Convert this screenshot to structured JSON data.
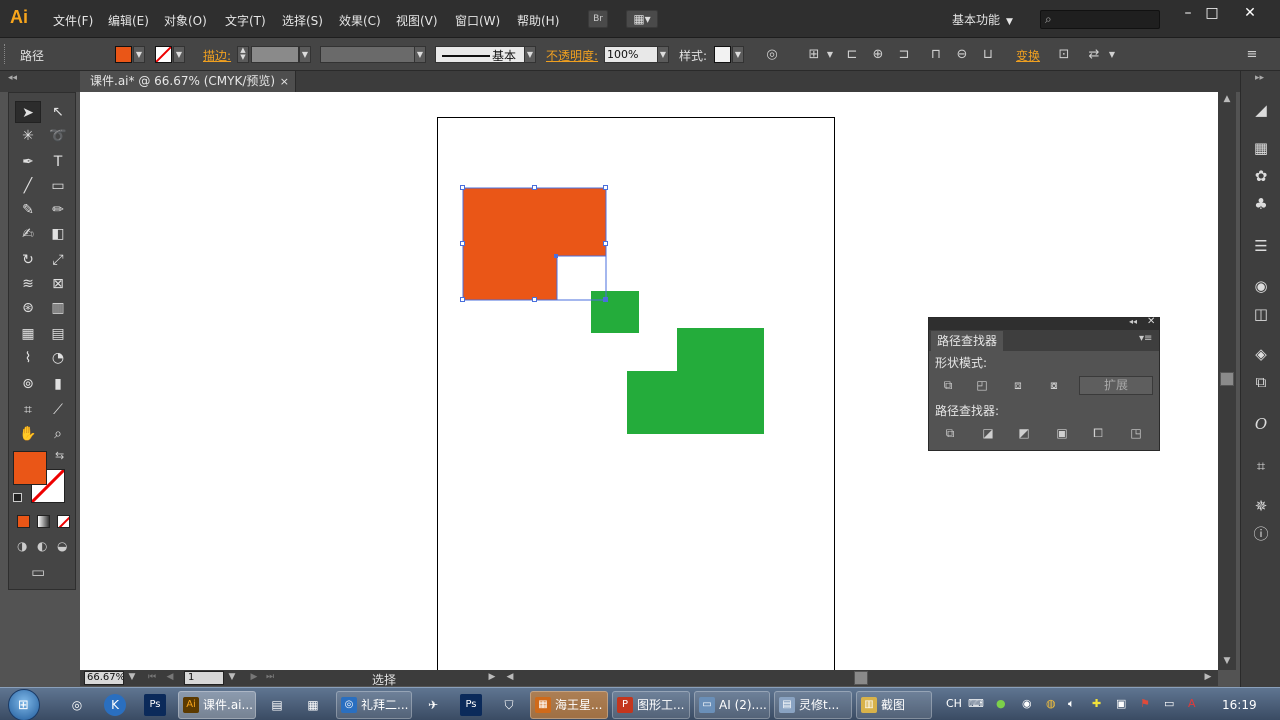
{
  "colors": {
    "fill_orange": "#ea5617",
    "shape_green": "#24ac3b",
    "selection_blue": "#4a6fdc",
    "accent_orange": "#f0a020"
  },
  "app": {
    "logo": "Ai"
  },
  "menubar": {
    "items": [
      "文件(F)",
      "编辑(E)",
      "对象(O)",
      "文字(T)",
      "选择(S)",
      "效果(C)",
      "视图(V)",
      "窗口(W)",
      "帮助(H)"
    ],
    "bridge_label": "Br",
    "workspace": "基本功能",
    "window_controls": {
      "minimize": "–",
      "maximize": "□",
      "close": "✕"
    }
  },
  "controlbar": {
    "selection_type": "路径",
    "stroke_label": "描边:",
    "stroke_style_label": "基本",
    "opacity_label": "不透明度:",
    "opacity_value": "100%",
    "style_label": "样式:",
    "transform_label": "变换"
  },
  "document": {
    "tab_title": "课件.ai* @ 66.67% (CMYK/预览)",
    "tab_close": "×"
  },
  "statusbar": {
    "zoom": "66.67%",
    "page": "1",
    "status": "选择"
  },
  "pathfinder": {
    "title": "路径查找器",
    "shape_modes_label": "形状模式:",
    "pathfinders_label": "路径查找器:",
    "expand_button": "扩展"
  },
  "taskbar": {
    "buttons": [
      {
        "label": "课件.ai...",
        "icon": "Ai",
        "icon_color": "#5c3a00"
      },
      {
        "label": "礼拜二...",
        "icon": "◎",
        "icon_color": "#2a6fc0"
      },
      {
        "label": "海王星...",
        "icon": "▦",
        "icon_color": "#d06a1a"
      },
      {
        "label": "图形工...",
        "icon": "P",
        "icon_color": "#c4361e"
      },
      {
        "label": "AI (2)....",
        "icon": "▭",
        "icon_color": "#6a8fb8"
      },
      {
        "label": "灵修t...",
        "icon": "▤",
        "icon_color": "#8aa3c2"
      },
      {
        "label": "截图",
        "icon": "▥",
        "icon_color": "#d8b24a"
      }
    ],
    "ime": "CH",
    "clock": "16:19"
  }
}
